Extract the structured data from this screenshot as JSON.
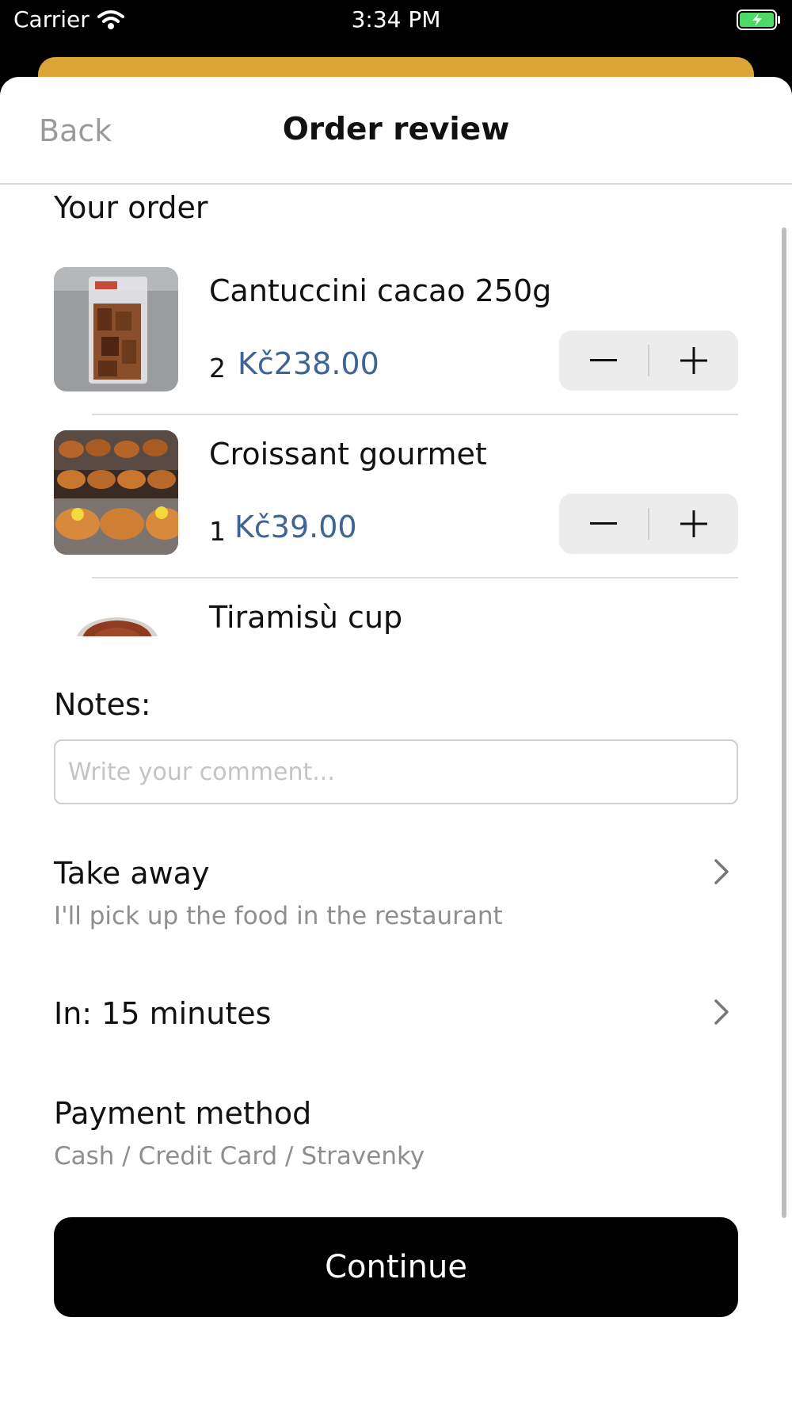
{
  "status_bar": {
    "carrier": "Carrier",
    "time": "3:34 PM",
    "battery_color": "#4cd964"
  },
  "nav": {
    "back_label": "Back",
    "title": "Order review"
  },
  "order": {
    "section_title": "Your order",
    "items": [
      {
        "name": "Cantuccini cacao 250g",
        "quantity": "2",
        "price": "Kč238.00"
      },
      {
        "name": "Croissant gourmet",
        "quantity": "1",
        "price": "Kč39.00"
      },
      {
        "name": "Tiramisù cup"
      }
    ]
  },
  "notes": {
    "label": "Notes:",
    "placeholder": "Write your comment..."
  },
  "delivery": {
    "title": "Take away",
    "subtitle": "I'll pick up the food in the restaurant"
  },
  "timing": {
    "title": "In: 15 minutes"
  },
  "payment": {
    "title": "Payment method",
    "subtitle": "Cash / Credit Card / Stravenky"
  },
  "continue_label": "Continue",
  "colors": {
    "accent_bar": "#dba637",
    "price": "#3d6494",
    "primary_button": "#000000"
  }
}
